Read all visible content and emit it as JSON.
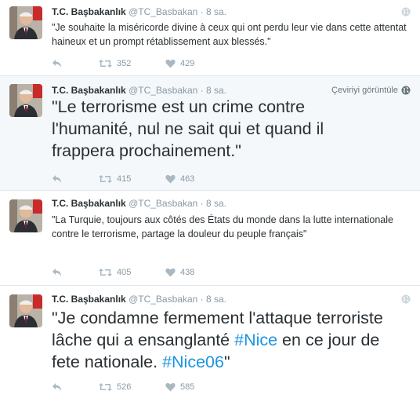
{
  "tweets": [
    {
      "name": "T.C. Başbakanlık",
      "handle": "@TC_Basbakan",
      "separator": "·",
      "time": "8 sa.",
      "text": "\"Je souhaite la miséricorde divine à ceux qui ont perdu leur vie dans cette attentat haineux et un prompt rétablissement aux blessés.\"",
      "retweets": "352",
      "likes": "429"
    },
    {
      "name": "T.C. Başbakanlık",
      "handle": "@TC_Basbakan",
      "separator": "·",
      "time": "8 sa.",
      "translate_label": "Çeviriyi görüntüle",
      "text": "\"Le terrorisme est un crime contre l'humanité, nul ne sait qui et quand il frappera prochainement.\"",
      "retweets": "415",
      "likes": "463"
    },
    {
      "name": "T.C. Başbakanlık",
      "handle": "@TC_Basbakan",
      "separator": "·",
      "time": "8 sa.",
      "text": "\"La Turquie, toujours aux côtés des États du monde dans la lutte internationale contre le terrorisme, partage la douleur du peuple français\"",
      "retweets": "405",
      "likes": "438"
    },
    {
      "name": "T.C. Başbakanlık",
      "handle": "@TC_Basbakan",
      "separator": "·",
      "time": "8 sa.",
      "text_part1": "\"Je condamne fermement l'attaque terroriste lâche qui a ensanglanté ",
      "hashtag1": "#Nice",
      "text_part2": " en ce jour de fete nationale. ",
      "hashtag2": "#Nice06",
      "text_part3": "\"",
      "retweets": "526",
      "likes": "585"
    }
  ],
  "colors": {
    "link": "#1b95e0",
    "muted": "#8899a6",
    "text": "#292f33",
    "hover_bg": "#f5f8fa",
    "border": "#e1e8ed"
  },
  "icons": [
    "reply-icon",
    "retweet-icon",
    "like-icon",
    "globe-icon",
    "avatar-photo"
  ]
}
